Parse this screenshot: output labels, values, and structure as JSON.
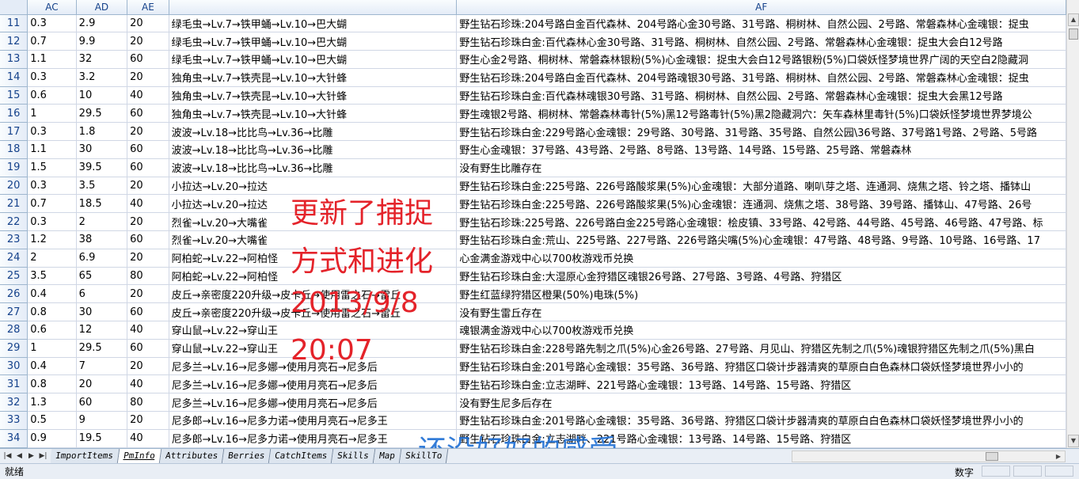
{
  "columns": [
    "AC",
    "AD",
    "AE",
    "AF"
  ],
  "rows": [
    {
      "n": "11",
      "ac": "0.3",
      "ad": "2.9",
      "ae": "20",
      "evo": "绿毛虫→Lv.7→铁甲蛹→Lv.10→巴大蝴",
      "af": "野生钻石珍珠:204号路白金百代森林、204号路心金30号路、31号路、桐树林、自然公园、2号路、常磐森林心金魂银：捉虫"
    },
    {
      "n": "12",
      "ac": "0.7",
      "ad": "9.9",
      "ae": "20",
      "evo": "绿毛虫→Lv.7→铁甲蛹→Lv.10→巴大蝴",
      "af": "野生钻石珍珠白金:百代森林心金30号路、31号路、桐树林、自然公园、2号路、常磐森林心金魂银：捉虫大会白12号路"
    },
    {
      "n": "13",
      "ac": "1.1",
      "ad": "32",
      "ae": "60",
      "evo": "绿毛虫→Lv.7→铁甲蛹→Lv.10→巴大蝴",
      "af": "野生心金2号路、桐树林、常磐森林银粉(5%)心金魂银：捉虫大会白12号路银粉(5%)口袋妖怪梦境世界广阔的天空白2隐藏洞"
    },
    {
      "n": "14",
      "ac": "0.3",
      "ad": "3.2",
      "ae": "20",
      "evo": "独角虫→Lv.7→铁壳昆→Lv.10→大针蜂",
      "af": "野生钻石珍珠:204号路白金百代森林、204号路魂银30号路、31号路、桐树林、自然公园、2号路、常磐森林心金魂银：捉虫"
    },
    {
      "n": "15",
      "ac": "0.6",
      "ad": "10",
      "ae": "40",
      "evo": "独角虫→Lv.7→铁壳昆→Lv.10→大针蜂",
      "af": "野生钻石珍珠白金:百代森林魂银30号路、31号路、桐树林、自然公园、2号路、常磐森林心金魂银：捉虫大会黑12号路"
    },
    {
      "n": "16",
      "ac": "1",
      "ad": "29.5",
      "ae": "60",
      "evo": "独角虫→Lv.7→铁壳昆→Lv.10→大针蜂",
      "af": "野生魂银2号路、桐树林、常磐森林毒针(5%)黑12号路毒针(5%)黑2隐藏洞穴：矢车森林里毒针(5%)口袋妖怪梦境世界梦境公"
    },
    {
      "n": "17",
      "ac": "0.3",
      "ad": "1.8",
      "ae": "20",
      "evo": "波波→Lv.18→比比鸟→Lv.36→比雕",
      "af": "野生钻石珍珠白金:229号路心金魂银：29号路、30号路、31号路、35号路、自然公园\\36号路、37号路1号路、2号路、5号路"
    },
    {
      "n": "18",
      "ac": "1.1",
      "ad": "30",
      "ae": "60",
      "evo": "波波→Lv.18→比比鸟→Lv.36→比雕",
      "af": "野生心金魂银：37号路、43号路、2号路、8号路、13号路、14号路、15号路、25号路、常磐森林"
    },
    {
      "n": "19",
      "ac": "1.5",
      "ad": "39.5",
      "ae": "60",
      "evo": "波波→Lv.18→比比鸟→Lv.36→比雕",
      "af": "没有野生比雕存在"
    },
    {
      "n": "20",
      "ac": "0.3",
      "ad": "3.5",
      "ae": "20",
      "evo": "小拉达→Lv.20→拉达",
      "af": "野生钻石珍珠白金:225号路、226号路酸浆果(5%)心金魂银：大部分道路、喇叭芽之塔、连通洞、烧焦之塔、铃之塔、播钵山"
    },
    {
      "n": "21",
      "ac": "0.7",
      "ad": "18.5",
      "ae": "40",
      "evo": "小拉达→Lv.20→拉达",
      "af": "野生钻石珍珠白金:225号路、226号路酸浆果(5%)心金魂银：连通洞、烧焦之塔、38号路、39号路、播钵山、47号路、26号"
    },
    {
      "n": "22",
      "ac": "0.3",
      "ad": "2",
      "ae": "20",
      "evo": "烈雀→Lv.20→大嘴雀",
      "af": "野生钻石珍珠:225号路、226号路白金225号路心金魂银：桧皮镇、33号路、42号路、44号路、45号路、46号路、47号路、标"
    },
    {
      "n": "23",
      "ac": "1.2",
      "ad": "38",
      "ae": "60",
      "evo": "烈雀→Lv.20→大嘴雀",
      "af": "野生钻石珍珠白金:荒山、225号路、227号路、226号路尖嘴(5%)心金魂银：47号路、48号路、9号路、10号路、16号路、17"
    },
    {
      "n": "24",
      "ac": "2",
      "ad": "6.9",
      "ae": "20",
      "evo": "阿柏蛇→Lv.22→阿柏怪",
      "af": "心金满金游戏中心以700枚游戏币兑换"
    },
    {
      "n": "25",
      "ac": "3.5",
      "ad": "65",
      "ae": "80",
      "evo": "阿柏蛇→Lv.22→阿柏怪",
      "af": "野生钻石珍珠白金:大湿原心金狩猎区魂银26号路、27号路、3号路、4号路、狩猎区"
    },
    {
      "n": "26",
      "ac": "0.4",
      "ad": "6",
      "ae": "20",
      "evo": "皮丘→亲密度220升级→皮卡丘→使用雷之石→雷丘",
      "af": "野生红蓝绿狩猎区橙果(50%)电珠(5%)"
    },
    {
      "n": "27",
      "ac": "0.8",
      "ad": "30",
      "ae": "60",
      "evo": "皮丘→亲密度220升级→皮卡丘→使用雷之石→雷丘",
      "af": "没有野生雷丘存在"
    },
    {
      "n": "28",
      "ac": "0.6",
      "ad": "12",
      "ae": "40",
      "evo": "穿山鼠→Lv.22→穿山王",
      "af": "魂银满金游戏中心以700枚游戏币兑换"
    },
    {
      "n": "29",
      "ac": "1",
      "ad": "29.5",
      "ae": "60",
      "evo": "穿山鼠→Lv.22→穿山王",
      "af": "野生钻石珍珠白金:228号路先制之爪(5%)心金26号路、27号路、月见山、狩猎区先制之爪(5%)魂银狩猎区先制之爪(5%)黑白"
    },
    {
      "n": "30",
      "ac": "0.4",
      "ad": "7",
      "ae": "20",
      "evo": "尼多兰→Lv.16→尼多娜→使用月亮石→尼多后",
      "af": "野生钻石珍珠白金:201号路心金魂银：35号路、36号路、狩猎区口袋计步器清爽的草原白白色森林口袋妖怪梦境世界小小的"
    },
    {
      "n": "31",
      "ac": "0.8",
      "ad": "20",
      "ae": "40",
      "evo": "尼多兰→Lv.16→尼多娜→使用月亮石→尼多后",
      "af": "野生钻石珍珠白金:立志湖畔、221号路心金魂银：13号路、14号路、15号路、狩猎区"
    },
    {
      "n": "32",
      "ac": "1.3",
      "ad": "60",
      "ae": "80",
      "evo": "尼多兰→Lv.16→尼多娜→使用月亮石→尼多后",
      "af": "没有野生尼多后存在"
    },
    {
      "n": "33",
      "ac": "0.5",
      "ad": "9",
      "ae": "20",
      "evo": "尼多郎→Lv.16→尼多力诺→使用月亮石→尼多王",
      "af": "野生钻石珍珠白金:201号路心金魂银：35号路、36号路、狩猎区口袋计步器清爽的草原白白色森林口袋妖怪梦境世界小小的"
    },
    {
      "n": "34",
      "ac": "0.9",
      "ad": "19.5",
      "ae": "40",
      "evo": "尼多郎→Lv.16→尼多力诺→使用月亮石→尼多王",
      "af": "野生钻石珍珠白金:立志湖畔、221号路心金魂银：13号路、14号路、15号路、狩猎区"
    }
  ],
  "sheet_tabs": [
    "ImportItems",
    "PmInfo",
    "Attributes",
    "Berries",
    "CatchItems",
    "Skills",
    "Map",
    "SkillTo"
  ],
  "active_tab": "PmInfo",
  "status": {
    "left": "就绪",
    "mode": "数字"
  },
  "overlay": {
    "line1": "更新了捕捉",
    "line2": "方式和进化",
    "line3": "2013/9/8",
    "line4": "20:07",
    "blue": "还没好好的感受"
  },
  "colors": {
    "overlay_red": "#e4232a",
    "overlay_blue": "#1f6fd4",
    "header_text": "#15428b"
  }
}
